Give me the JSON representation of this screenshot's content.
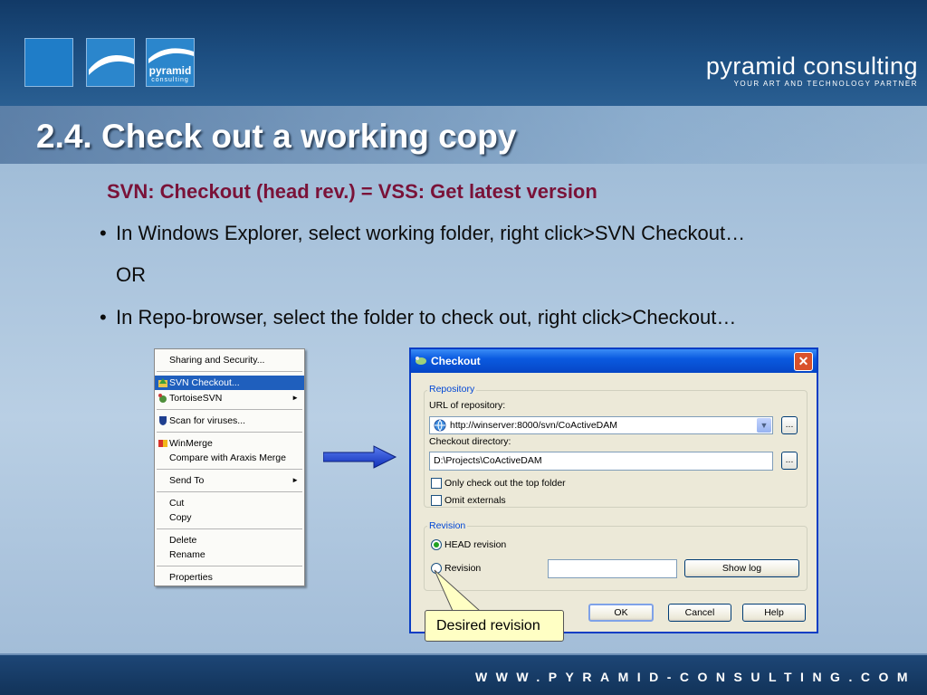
{
  "header": {
    "logo_text": "pyramid",
    "logo_subtext": "consulting",
    "brand_name": "pyramid consulting",
    "brand_tagline": "YOUR ART AND TECHNOLOGY PARTNER"
  },
  "slide": {
    "title": "2.4. Check out a working copy",
    "subtitle": "SVN: Checkout (head rev.) = VSS: Get latest version",
    "bullet1": "In Windows Explorer, select working folder, right click>SVN Checkout…",
    "or": "OR",
    "bullet2": "In Repo-browser, select the folder to check out, right click>Checkout…",
    "bullet_char": "•"
  },
  "context_menu": {
    "items": [
      {
        "label": "Sharing and Security..."
      },
      {
        "label": "SVN Checkout...",
        "icon": "svn-checkout-icon"
      },
      {
        "label": "TortoiseSVN",
        "icon": "tortoisesvn-icon",
        "submenu": "►"
      },
      {
        "label": "Scan for viruses...",
        "icon": "shield-icon"
      },
      {
        "label": "WinMerge",
        "icon": "winmerge-icon"
      },
      {
        "label": "Compare with Araxis Merge"
      },
      {
        "label": "Send To",
        "submenu": "►"
      },
      {
        "label": "Cut"
      },
      {
        "label": "Copy"
      },
      {
        "label": "Delete"
      },
      {
        "label": "Rename"
      },
      {
        "label": "Properties"
      }
    ],
    "selected": "SVN Checkout..."
  },
  "dialog": {
    "title": "Checkout",
    "close": "✕",
    "repository_group": "Repository",
    "url_label": "URL of repository:",
    "url_value": "http://winserver:8000/svn/CoActiveDAM",
    "browse_label": "...",
    "dir_label": "Checkout directory:",
    "dir_value": "D:\\Projects\\CoActiveDAM",
    "only_top_folder": "Only check out the top folder",
    "omit_externals": "Omit externals",
    "revision_group": "Revision",
    "head_revision": "HEAD revision",
    "revision": "Revision",
    "revision_value": "",
    "show_log": "Show log",
    "ok": "OK",
    "cancel": "Cancel",
    "help": "Help",
    "dropdown_arrow": "▼"
  },
  "callout": {
    "text": "Desired revision"
  },
  "footer": {
    "url": "WWW.PYRAMID-CONSULTING.COM"
  },
  "colors": {
    "subtitle": "#7a1238",
    "header_bg": "#123a67",
    "menu_highlight": "#1f5fbd",
    "xp_titlebar": "#0a5ae0",
    "callout_bg": "#ffffc4"
  }
}
